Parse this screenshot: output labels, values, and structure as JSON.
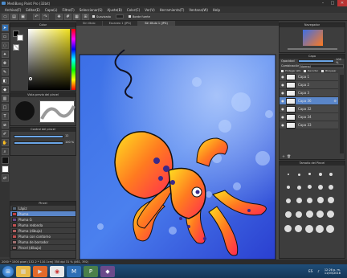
{
  "window": {
    "title": "MediBang Paint Pro (32bit)",
    "min": "–",
    "max": "□",
    "close": "✕"
  },
  "menu": [
    "Archivo(F)",
    "Editar(E)",
    "Capa(L)",
    "Filtro(F)",
    "Seleccionar(S)",
    "Ajuste(B)",
    "Color(C)",
    "Ver(V)",
    "Herramienta(T)",
    "Ventana(W)",
    "Help"
  ],
  "toolbar": {
    "anti_alias": "Suavizado",
    "corrector": "Corrección",
    "border": "Borde fuerte"
  },
  "tabs": [
    "Sin título",
    "Escaneo 1 (JPG)",
    "Sin título 1 (JPG)"
  ],
  "color_panel": {
    "title": "Color"
  },
  "brush_preview": {
    "title": "Vista previa del pincel"
  },
  "brush_control": {
    "title": "Control del pincel",
    "size": "12",
    "opacity": "100 %"
  },
  "brush_list": {
    "title": "Pincel",
    "items": [
      {
        "label": "Lápiz",
        "color": "#556677"
      },
      {
        "label": "Pluma",
        "color": "#c04040",
        "selected": true
      },
      {
        "label": "Pluma G",
        "color": "#6a4a8a"
      },
      {
        "label": "Pluma redonda",
        "color": "#c05050"
      },
      {
        "label": "Pluma (dibuja)",
        "color": "#b06060"
      },
      {
        "label": "Pluma con contorno",
        "color": "#c05050"
      },
      {
        "label": "Pluma de borrador",
        "color": "#a07070"
      },
      {
        "label": "Pincel (dibuja)",
        "color": "#806060"
      }
    ]
  },
  "navigator": {
    "title": "Navegador"
  },
  "layer_panel": {
    "title": "Capa",
    "opacity_label": "Opacidad",
    "opacity_value": "100 %",
    "blend_label": "Combinación",
    "blend_value": "Normal",
    "protect": "Proteger alfa",
    "clipping": "Recortar",
    "lock": "Bloquear",
    "layers": [
      {
        "name": "Capa 1",
        "selected": false
      },
      {
        "name": "Capa 2",
        "selected": false
      },
      {
        "name": "Capa 3",
        "selected": false
      },
      {
        "name": "Capa 36",
        "selected": true
      },
      {
        "name": "Capa 32",
        "selected": false
      },
      {
        "name": "Capa 34",
        "selected": false
      },
      {
        "name": "Capa 33",
        "selected": false
      }
    ]
  },
  "brush_size_panel": {
    "title": "Tamaño del Pincel"
  },
  "status": {
    "text": "2000 * 1500 pixel  (132.2 * 110.1cm)  350 dpi  31 %  (461, 392)"
  },
  "taskbar": {
    "lang": "ES",
    "time": "12:26 p. m.",
    "date": "11/03/2018"
  }
}
